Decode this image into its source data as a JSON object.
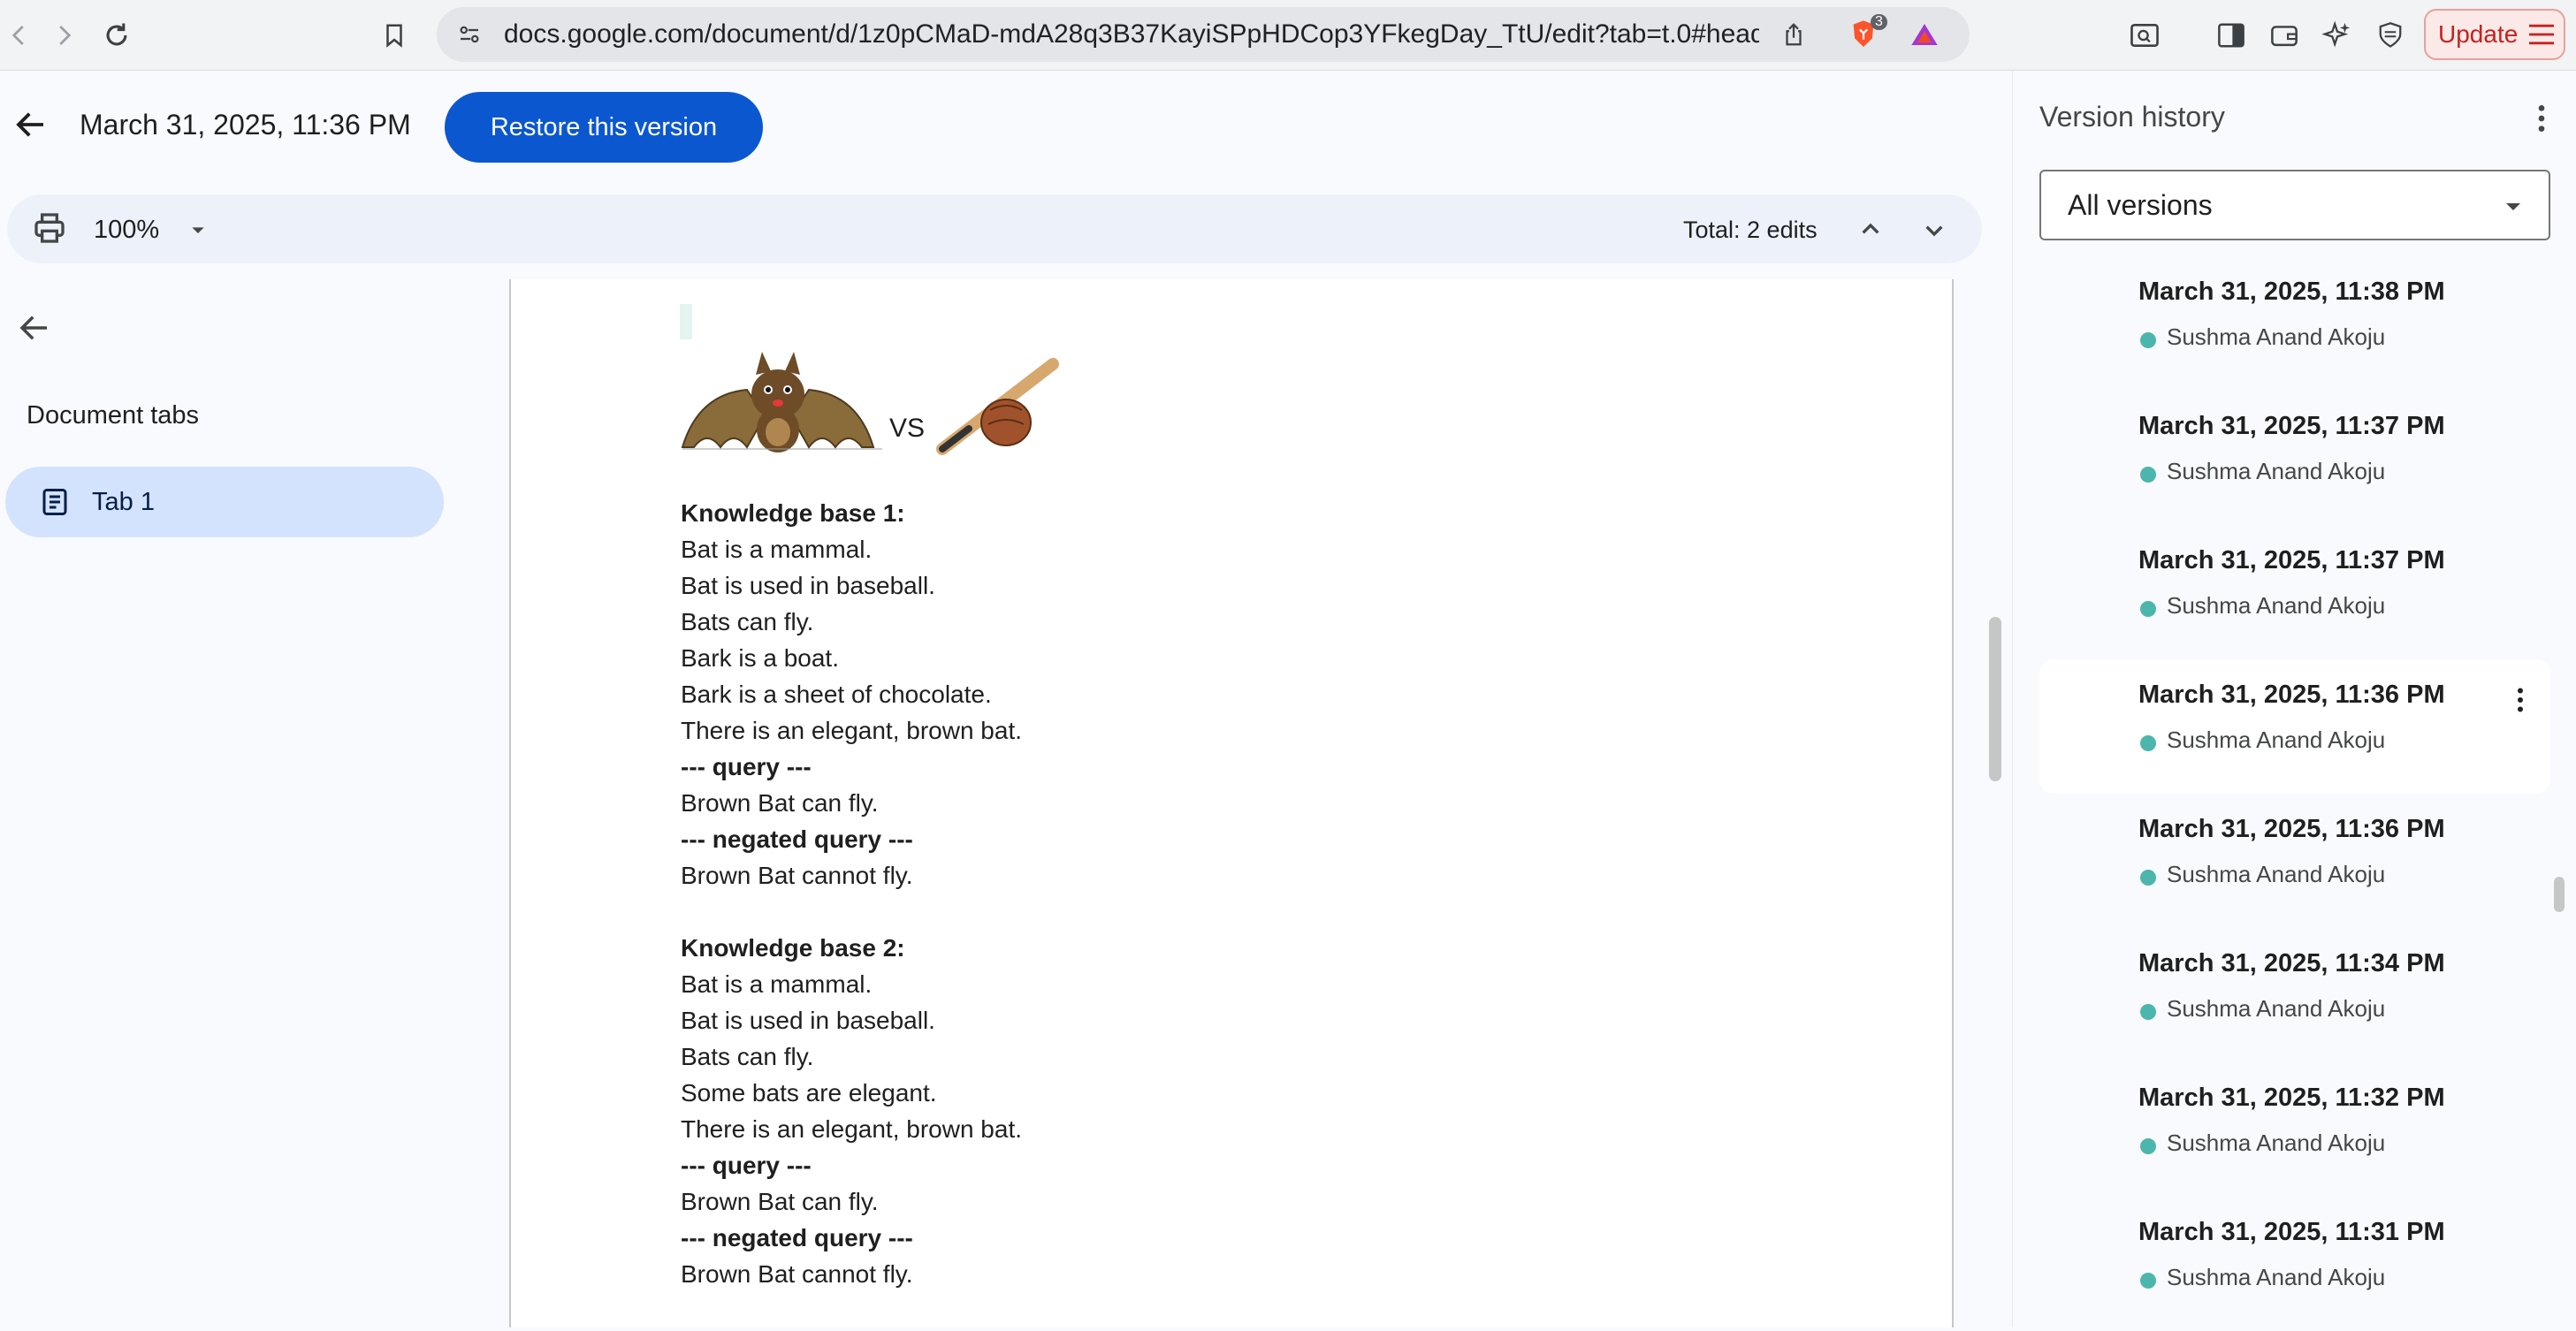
{
  "browser": {
    "url": "docs.google.com/document/d/1z0pCMaD-mdA28q3B37KayiSPpHDCop3YFkegDay_TtU/edit?tab=t.0#head...",
    "shield_badge": "3",
    "update_label": "Update"
  },
  "header": {
    "version_title": "March 31, 2025, 11:36 PM",
    "restore_label": "Restore this version"
  },
  "toolbar": {
    "zoom": "100%",
    "edits_label": "Total: 2 edits"
  },
  "outline": {
    "heading": "Document tabs",
    "tabs": [
      {
        "label": "Tab 1"
      }
    ]
  },
  "document": {
    "images_separator": "VS",
    "kb1": {
      "heading": "Knowledge base 1:",
      "facts": [
        "Bat is a mammal.",
        "Bat is used in baseball.",
        "Bats can fly.",
        "Bark is a boat.",
        "Bark is a sheet of chocolate.",
        "There is an elegant, brown bat."
      ],
      "query_label": "--- query ---",
      "query": "Brown Bat can fly.",
      "negated_label": "--- negated query ---",
      "negated": "Brown Bat cannot fly."
    },
    "kb2": {
      "heading": "Knowledge base 2:",
      "facts": [
        "Bat is a mammal.",
        "Bat is used in baseball.",
        "Bats can fly.",
        "Some bats are elegant.",
        "There is an elegant, brown bat."
      ],
      "query_label": "--- query ---",
      "query": "Brown Bat can fly.",
      "negated_label": "--- negated query ---",
      "negated": "Brown Bat cannot fly."
    }
  },
  "version_history": {
    "title": "Version history",
    "filter": "All versions",
    "versions": [
      {
        "when": "March 31, 2025, 11:38 PM",
        "author": "Sushma Anand Akoju",
        "selected": false
      },
      {
        "when": "March 31, 2025, 11:37 PM",
        "author": "Sushma Anand Akoju",
        "selected": false
      },
      {
        "when": "March 31, 2025, 11:37 PM",
        "author": "Sushma Anand Akoju",
        "selected": false
      },
      {
        "when": "March 31, 2025, 11:36 PM",
        "author": "Sushma Anand Akoju",
        "selected": true
      },
      {
        "when": "March 31, 2025, 11:36 PM",
        "author": "Sushma Anand Akoju",
        "selected": false
      },
      {
        "when": "March 31, 2025, 11:34 PM",
        "author": "Sushma Anand Akoju",
        "selected": false
      },
      {
        "when": "March 31, 2025, 11:32 PM",
        "author": "Sushma Anand Akoju",
        "selected": false
      },
      {
        "when": "March 31, 2025, 11:31 PM",
        "author": "Sushma Anand Akoju",
        "selected": false
      }
    ]
  },
  "colors": {
    "accent": "#0b57d0",
    "tab_selected": "#d3e3fd",
    "author_dot": "#4db6ac"
  }
}
